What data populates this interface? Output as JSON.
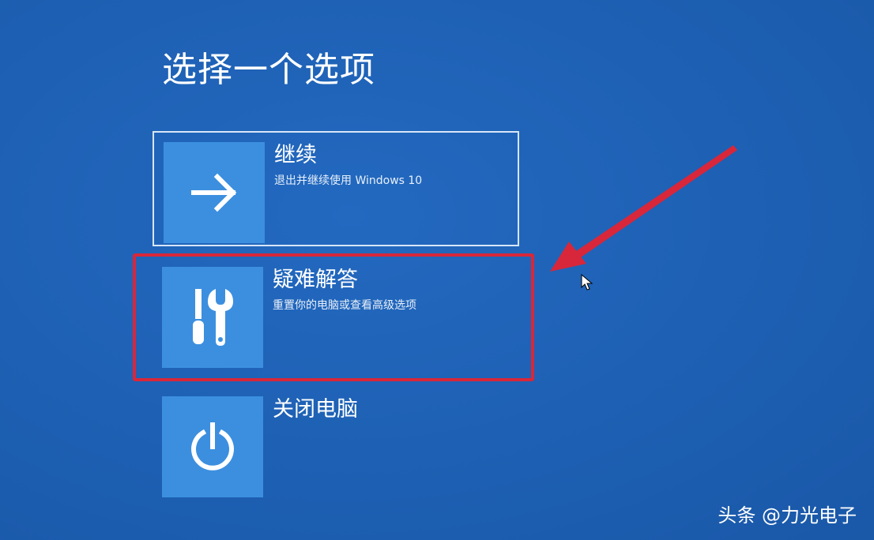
{
  "page": {
    "title": "选择一个选项"
  },
  "options": [
    {
      "label": "继续",
      "description": "退出并继续使用 Windows 10",
      "icon": "arrow-right-icon"
    },
    {
      "label": "疑难解答",
      "description": "重置你的电脑或查看高级选项",
      "icon": "tools-icon"
    },
    {
      "label": "关闭电脑",
      "description": "",
      "icon": "power-icon"
    }
  ],
  "annotation": {
    "highlight_color": "#d8273a",
    "arrow_color": "#d8273a"
  },
  "watermark": {
    "text": "头条 @力光电子"
  },
  "colors": {
    "background": "#1f63b8",
    "tile": "#3c8fdf",
    "text": "#ffffff"
  }
}
